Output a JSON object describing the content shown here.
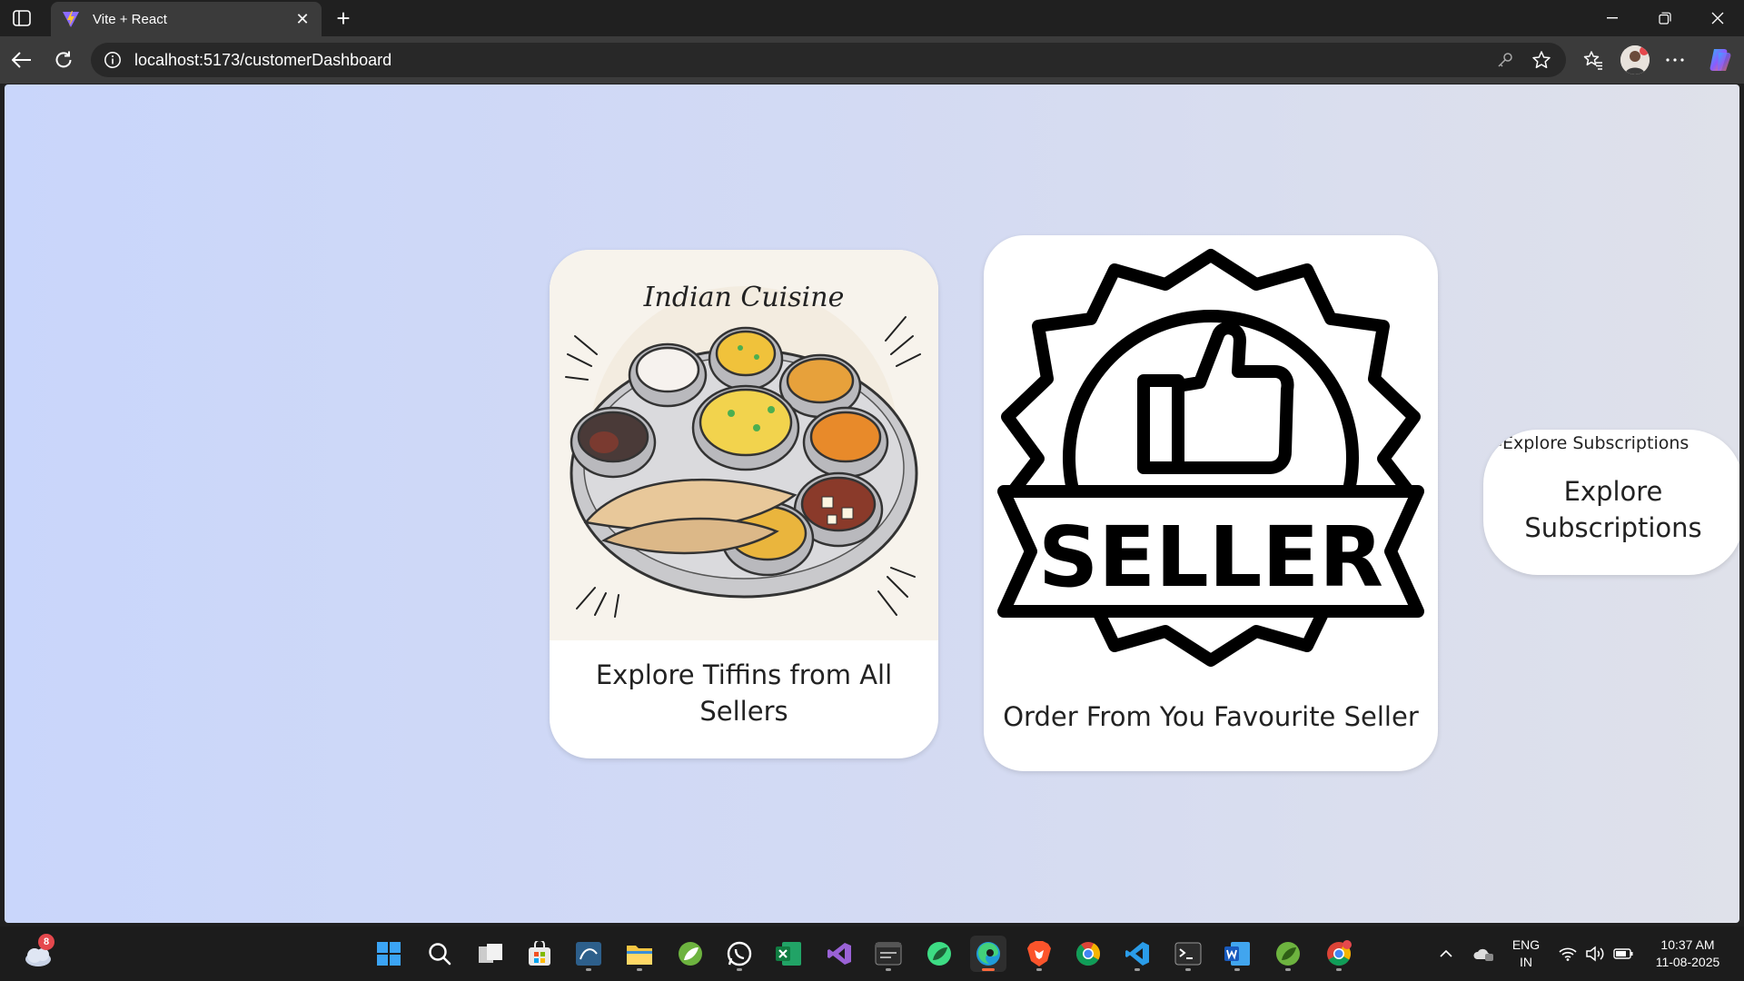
{
  "browser": {
    "tab_title": "Vite + React",
    "url": "localhost:5173/customerDashboard"
  },
  "cards": {
    "tiffins": {
      "image_text": "Indian Cuisine",
      "caption": "Explore Tiffins from All Sellers"
    },
    "seller": {
      "badge_text": "SELLER",
      "caption": "Order From You Favourite Seller"
    },
    "subscriptions": {
      "broken_image_alt": "Explore Subscriptions",
      "caption": "Explore Subscriptions"
    }
  },
  "taskbar": {
    "weather_badge": "8",
    "language": [
      "ENG",
      "IN"
    ],
    "time": "10:37 AM",
    "date": "11-08-2025",
    "apps": [
      "start",
      "search",
      "task-view",
      "store",
      "mysql-workbench",
      "file-explorer",
      "spring-tools",
      "whatsapp",
      "excel",
      "visual-studio",
      "terminal-app",
      "android-studio",
      "edge",
      "brave",
      "chrome",
      "vscode",
      "command-prompt",
      "word",
      "spring-tools-2",
      "chrome-profile"
    ]
  },
  "colors": {
    "page_gradient_start": "#c9d6fb",
    "page_gradient_end": "#dfe1ea",
    "card_bg": "#ffffff",
    "chrome_dark": "#202020",
    "chrome_toolbar": "#3b3b3b"
  }
}
